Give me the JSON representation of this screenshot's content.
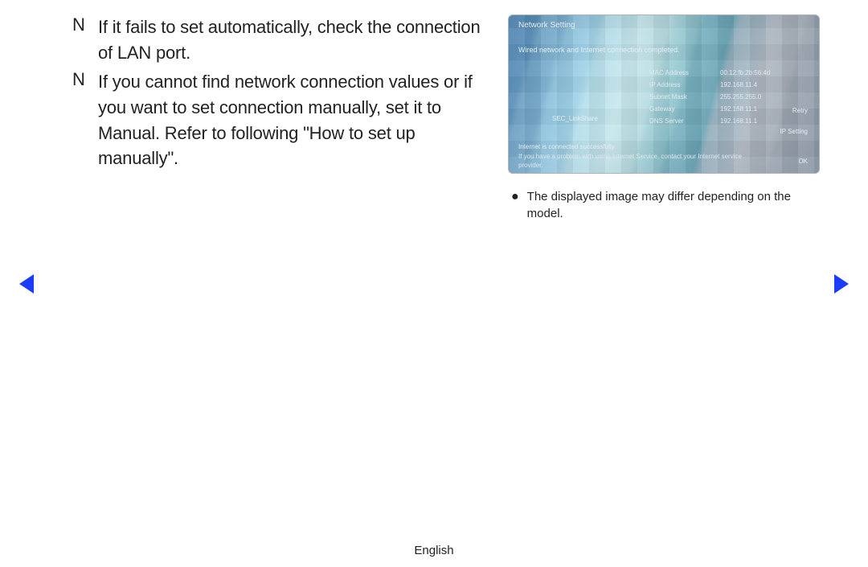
{
  "notes": [
    {
      "marker": "N",
      "text": " If it fails to set automatically, check the connection of LAN port."
    },
    {
      "marker": "N",
      "text": "If you cannot find network connection values or if you want to set connection manually, set it to Manual. Refer to following \"How to set up manually\"."
    }
  ],
  "screenshot": {
    "title": "Network Setting",
    "subtitle": "Wired network and Internet connection completed.",
    "rows": [
      {
        "label": "MAC Address",
        "value": "00:12:fb:2b:56:4d"
      },
      {
        "label": "IP Address",
        "value": "192.168.11.4"
      },
      {
        "label": "Subnet Mask",
        "value": "255.255.255.0"
      },
      {
        "label": "Gateway",
        "value": "192.168.11.1"
      },
      {
        "label": "DNS Server",
        "value": "192.168.11.1"
      }
    ],
    "leftlabel": "SEC_LinkShare",
    "retry": "Retry",
    "ipsetting": "IP Setting",
    "ok": "OK",
    "footer1": "Internet is connected successfully.",
    "footer2": "If you have a problem with using Internet Service, contact your Internet service",
    "footer3": "provider."
  },
  "caption": "The displayed image may differ depending on the model.",
  "language": "English"
}
